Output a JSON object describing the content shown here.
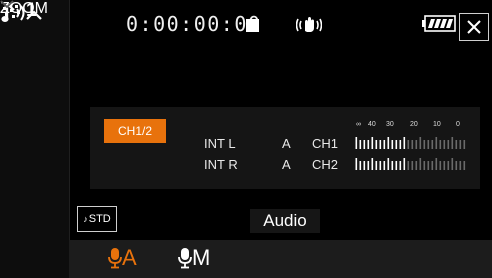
{
  "sidebar": {
    "zoom_label": "ZOOM",
    "nd_label": "1"
  },
  "status": {
    "timecode": "0:00:00:00"
  },
  "audio_panel": {
    "channel_button": "CH1/2",
    "scale_labels": [
      "∞",
      "40",
      "30",
      "20",
      "10",
      "0"
    ],
    "rows": [
      {
        "input": "INT L",
        "mode": "A",
        "channel": "CH1",
        "level": 0.45
      },
      {
        "input": "INT R",
        "mode": "A",
        "channel": "CH2",
        "level": 0.45
      }
    ]
  },
  "std_button": "STD",
  "screen_title": "Audio",
  "bottom_bar": {
    "auto_label": "A",
    "manual_label": "M"
  },
  "colors": {
    "accent": "#e8720c",
    "background": "#000000"
  }
}
